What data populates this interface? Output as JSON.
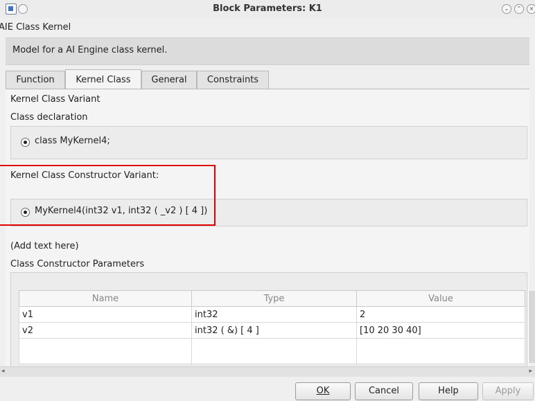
{
  "window": {
    "title": "Block Parameters: K1",
    "controls": [
      "minimize-icon",
      "maximize-icon",
      "close-icon"
    ],
    "control_glyphs": {
      "minimize": "⌄",
      "maximize": "⌃",
      "close": "×"
    }
  },
  "dialog": {
    "header": "AIE Class Kernel",
    "description": "Model for a AI Engine class kernel."
  },
  "tabs": [
    {
      "label": "Function",
      "active": false
    },
    {
      "label": "Kernel Class",
      "active": true
    },
    {
      "label": "General",
      "active": false
    },
    {
      "label": "Constraints",
      "active": false
    }
  ],
  "panel": {
    "variant_label": "Kernel Class Variant",
    "declaration_label": "Class declaration",
    "declaration_option": "class MyKernel4;",
    "constructor_variant_label": "Kernel Class Constructor Variant:",
    "constructor_option": "MyKernel4(int32 v1, int32 ( _v2 ) [ 4 ])",
    "add_text": "(Add text here)",
    "params_label": "Class Constructor Parameters"
  },
  "table": {
    "headers": [
      "Name",
      "Type",
      "Value"
    ],
    "rows": [
      [
        "v1",
        "int32",
        "2"
      ],
      [
        "v2",
        "int32 ( &) [ 4 ]",
        "[10 20 30 40]"
      ]
    ]
  },
  "buttons": {
    "ok": "OK",
    "cancel": "Cancel",
    "help": "Help",
    "apply": "Apply"
  },
  "colors": {
    "highlight_border": "#e00000"
  }
}
